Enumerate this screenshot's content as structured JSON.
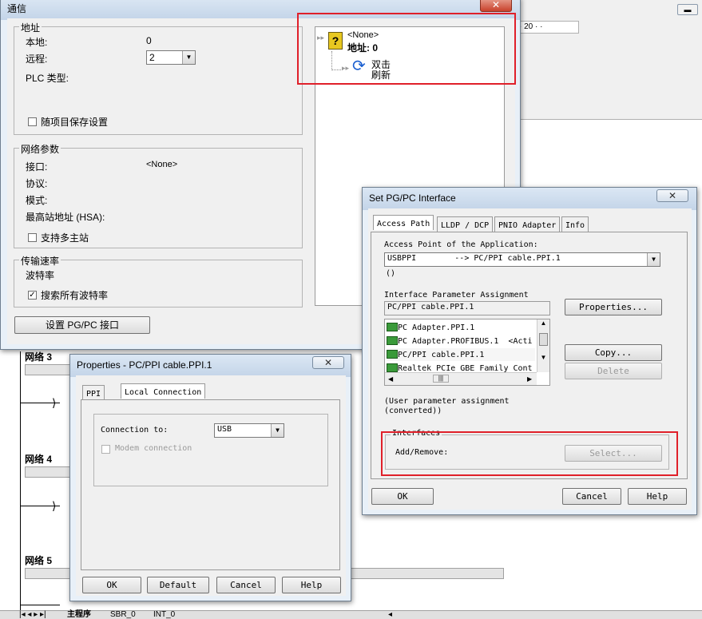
{
  "background": {
    "network3_label": "网络 3",
    "network4_label": "网络 4",
    "network5_label": "网络 5",
    "ruler_text": "· 20 · ·",
    "tabs": [
      "主程序",
      "SBR_0",
      "INT_0"
    ]
  },
  "comm": {
    "title": "通信",
    "address": {
      "group": "地址",
      "local_label": "本地:",
      "local_value": "0",
      "remote_label": "远程:",
      "remote_value": "2",
      "plc_type_label": "PLC 类型:",
      "save_settings_label": "随项目保存设置"
    },
    "network": {
      "group": "网络参数",
      "interface_label": "接口:",
      "interface_value": "<None>",
      "protocol_label": "协议:",
      "mode_label": "模式:",
      "hsa_label": "最高站地址 (HSA):",
      "multimaster_label": "支持多主站"
    },
    "baud": {
      "group": "传输速率",
      "rate_label": "波特率",
      "search_all_label": "搜索所有波特率",
      "search_all_checked": "✓"
    },
    "set_pgpc_button": "设置 PG/PC 接口",
    "tree": {
      "node_name": "<None>",
      "node_address": "地址: 0",
      "refresh_line1": "双击",
      "refresh_line2": "刷新"
    }
  },
  "pgpc": {
    "title": "Set PG/PC Interface",
    "tabs": [
      "Access Path",
      "LLDP / DCP",
      "PNIO Adapter",
      "Info"
    ],
    "access_point_label": "Access Point of the Application:",
    "access_point_value": "USBPPI        --> PC/PPI cable.PPI.1",
    "access_point_sub": "()",
    "param_assign_label": "Interface Parameter Assignment",
    "param_assign_value": "PC/PPI cable.PPI.1",
    "properties_button": "Properties...",
    "list_items": [
      "PC Adapter.PPI.1",
      "PC Adapter.PROFIBUS.1  <Acti",
      "PC/PPI cable.PPI.1",
      "Realtek PCIe GBE Family Cont"
    ],
    "copy_button": "Copy...",
    "delete_button": "Delete",
    "user_param_line1": "(User parameter assignment",
    "user_param_line2": "(converted))",
    "interfaces_group": "Interfaces",
    "add_remove_label": "Add/Remove:",
    "select_button": "Select...",
    "ok_button": "OK",
    "cancel_button": "Cancel",
    "help_button": "Help"
  },
  "props": {
    "title": "Properties - PC/PPI cable.PPI.1",
    "tabs": [
      "PPI",
      "Local Connection"
    ],
    "connection_label": "Connection to:",
    "connection_value": "USB",
    "modem_label": "Modem connection",
    "ok_button": "OK",
    "default_button": "Default",
    "cancel_button": "Cancel",
    "help_button": "Help"
  },
  "colors": {
    "highlight_red": "#e0202a",
    "refresh_blue": "#1a5fd0"
  }
}
